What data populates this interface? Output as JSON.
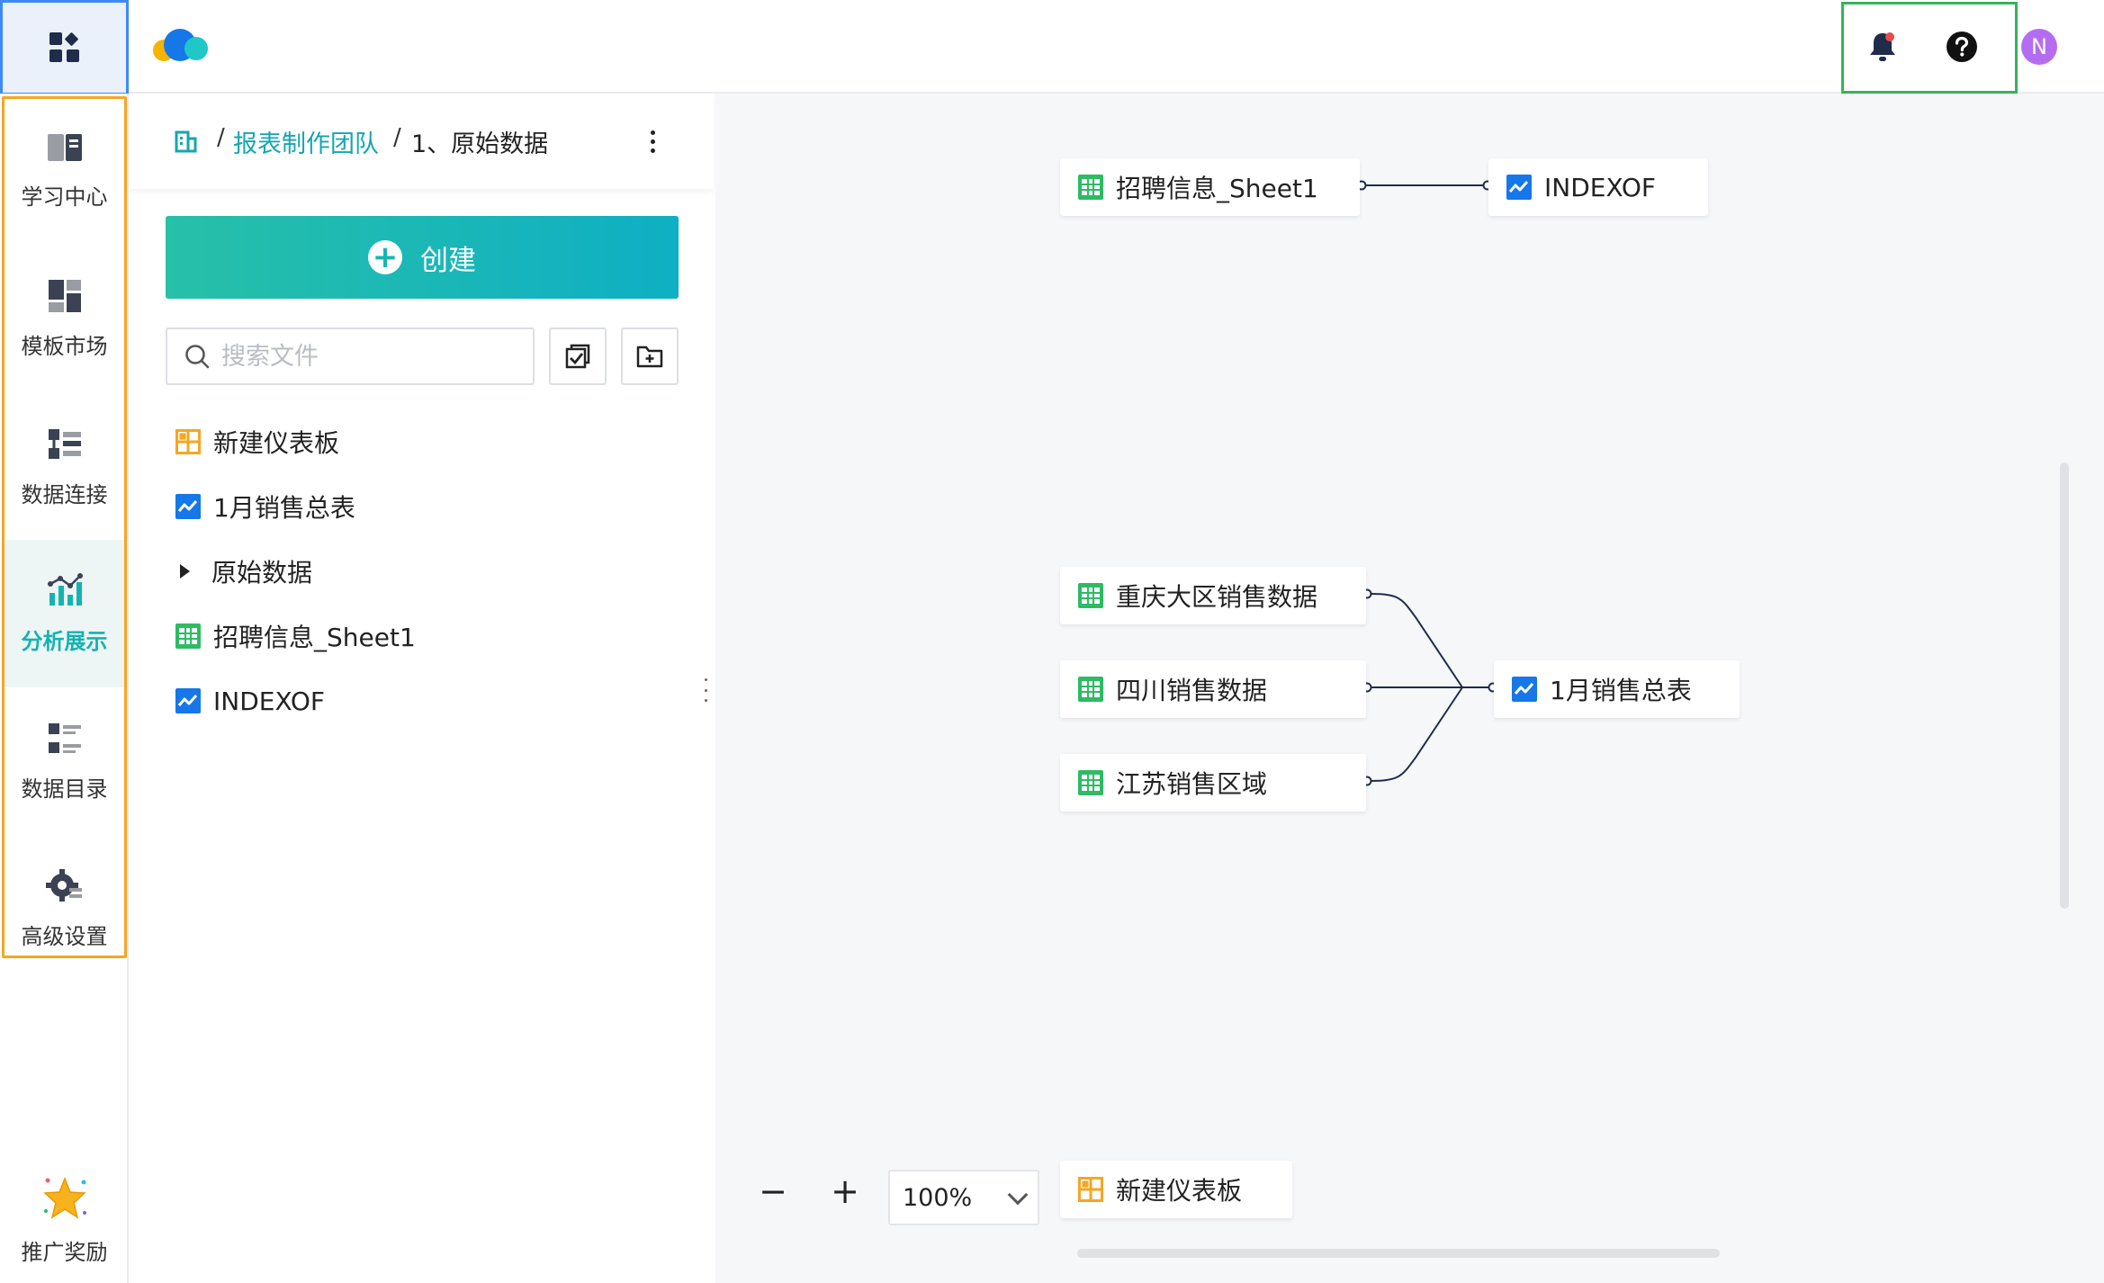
{
  "topbar": {
    "bell_badge_color": "#e84b4b",
    "avatar_letter": "N"
  },
  "rail": {
    "items": [
      {
        "label": "学习中心",
        "icon": "book-icon"
      },
      {
        "label": "模板市场",
        "icon": "template-icon"
      },
      {
        "label": "数据连接",
        "icon": "data-connect-icon"
      },
      {
        "label": "分析展示",
        "icon": "chart-icon",
        "active": true
      },
      {
        "label": "数据目录",
        "icon": "catalog-icon"
      },
      {
        "label": "高级设置",
        "icon": "settings-icon"
      }
    ],
    "promo_label": "推广奖励"
  },
  "panel": {
    "breadcrumb": {
      "sep": "/",
      "team": "报表制作团队",
      "current": "1、原始数据"
    },
    "create_label": "创建",
    "search_placeholder": "搜索文件",
    "files": [
      {
        "name": "新建仪表板",
        "type": "dashboard"
      },
      {
        "name": "1月销售总表",
        "type": "report"
      },
      {
        "name": "原始数据",
        "type": "folder"
      },
      {
        "name": "招聘信息_Sheet1",
        "type": "table"
      },
      {
        "name": "INDEXOF",
        "type": "report"
      }
    ]
  },
  "canvas": {
    "nodes": {
      "recruit_sheet": "招聘信息_Sheet1",
      "indexof": "INDEXOF",
      "chongqing": "重庆大区销售数据",
      "sichuan": "四川销售数据",
      "jiangsu": "江苏销售区域",
      "jan_sales": "1月销售总表",
      "new_dashboard": "新建仪表板"
    },
    "zoom": {
      "minus": "−",
      "plus": "+",
      "value": "100%"
    }
  },
  "colors": {
    "accent": "#15b3b0",
    "table_green": "#2dbb64",
    "report_blue": "#1677e8",
    "dashboard_orange": "#f5a623"
  }
}
